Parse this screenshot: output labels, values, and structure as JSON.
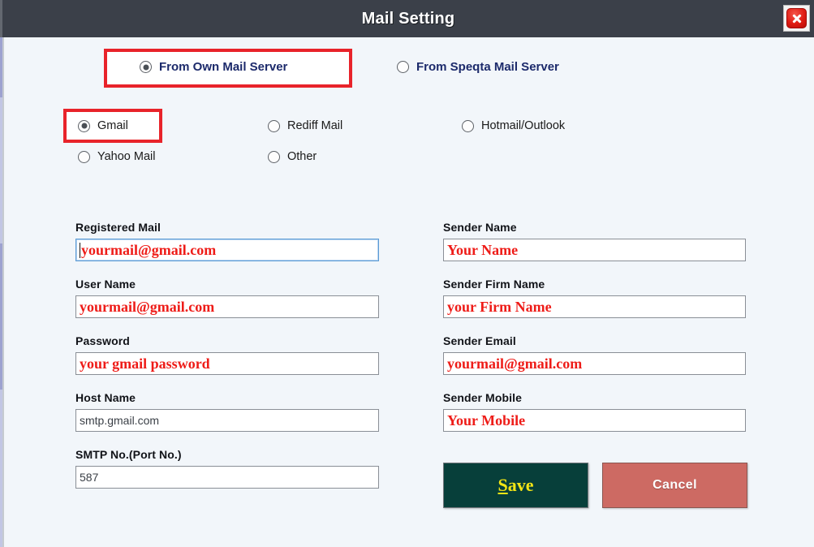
{
  "window": {
    "title": "Mail Setting",
    "close_icon": "close-icon",
    "titlebar_color": "#3b4049",
    "background_color": "#f2f6fa"
  },
  "source_radios": {
    "options": [
      {
        "label": "From Own Mail Server",
        "selected": true,
        "highlighted": true
      },
      {
        "label": "From Speqta Mail Server",
        "selected": false,
        "highlighted": false
      }
    ]
  },
  "provider_radios": {
    "options": [
      {
        "label": "Gmail",
        "selected": true,
        "highlighted": true
      },
      {
        "label": "Rediff Mail",
        "selected": false,
        "highlighted": false
      },
      {
        "label": "Hotmail/Outlook",
        "selected": false,
        "highlighted": false
      },
      {
        "label": "Yahoo Mail",
        "selected": false,
        "highlighted": false
      },
      {
        "label": "Other",
        "selected": false,
        "highlighted": false
      }
    ]
  },
  "form": {
    "left": [
      {
        "label": "Registered Mail",
        "value": "yourmail@gmail.com",
        "kind": "placeholder",
        "focused": true
      },
      {
        "label": "User Name",
        "value": "yourmail@gmail.com",
        "kind": "placeholder",
        "focused": false
      },
      {
        "label": "Password",
        "value": "your gmail password",
        "kind": "placeholder",
        "focused": false
      },
      {
        "label": "Host Name",
        "value": "smtp.gmail.com",
        "kind": "real",
        "focused": false
      },
      {
        "label": "SMTP No.(Port No.)",
        "value": "587",
        "kind": "real",
        "focused": false
      }
    ],
    "right": [
      {
        "label": "Sender Name",
        "value": "Your Name",
        "kind": "placeholder",
        "focused": false
      },
      {
        "label": "Sender Firm Name",
        "value": "your Firm Name",
        "kind": "placeholder",
        "focused": false
      },
      {
        "label": "Sender Email",
        "value": "yourmail@gmail.com",
        "kind": "placeholder",
        "focused": false
      },
      {
        "label": "Sender Mobile",
        "value": "Your Mobile",
        "kind": "placeholder",
        "focused": false
      }
    ]
  },
  "buttons": {
    "save": {
      "accel": "S",
      "rest": "ave",
      "full": "Save",
      "bg": "#073f3a",
      "fg": "#f3e515"
    },
    "cancel": {
      "label": "Cancel",
      "bg": "#cd6a63",
      "fg": "#ffffff"
    }
  },
  "highlight_color": "#e8232a"
}
